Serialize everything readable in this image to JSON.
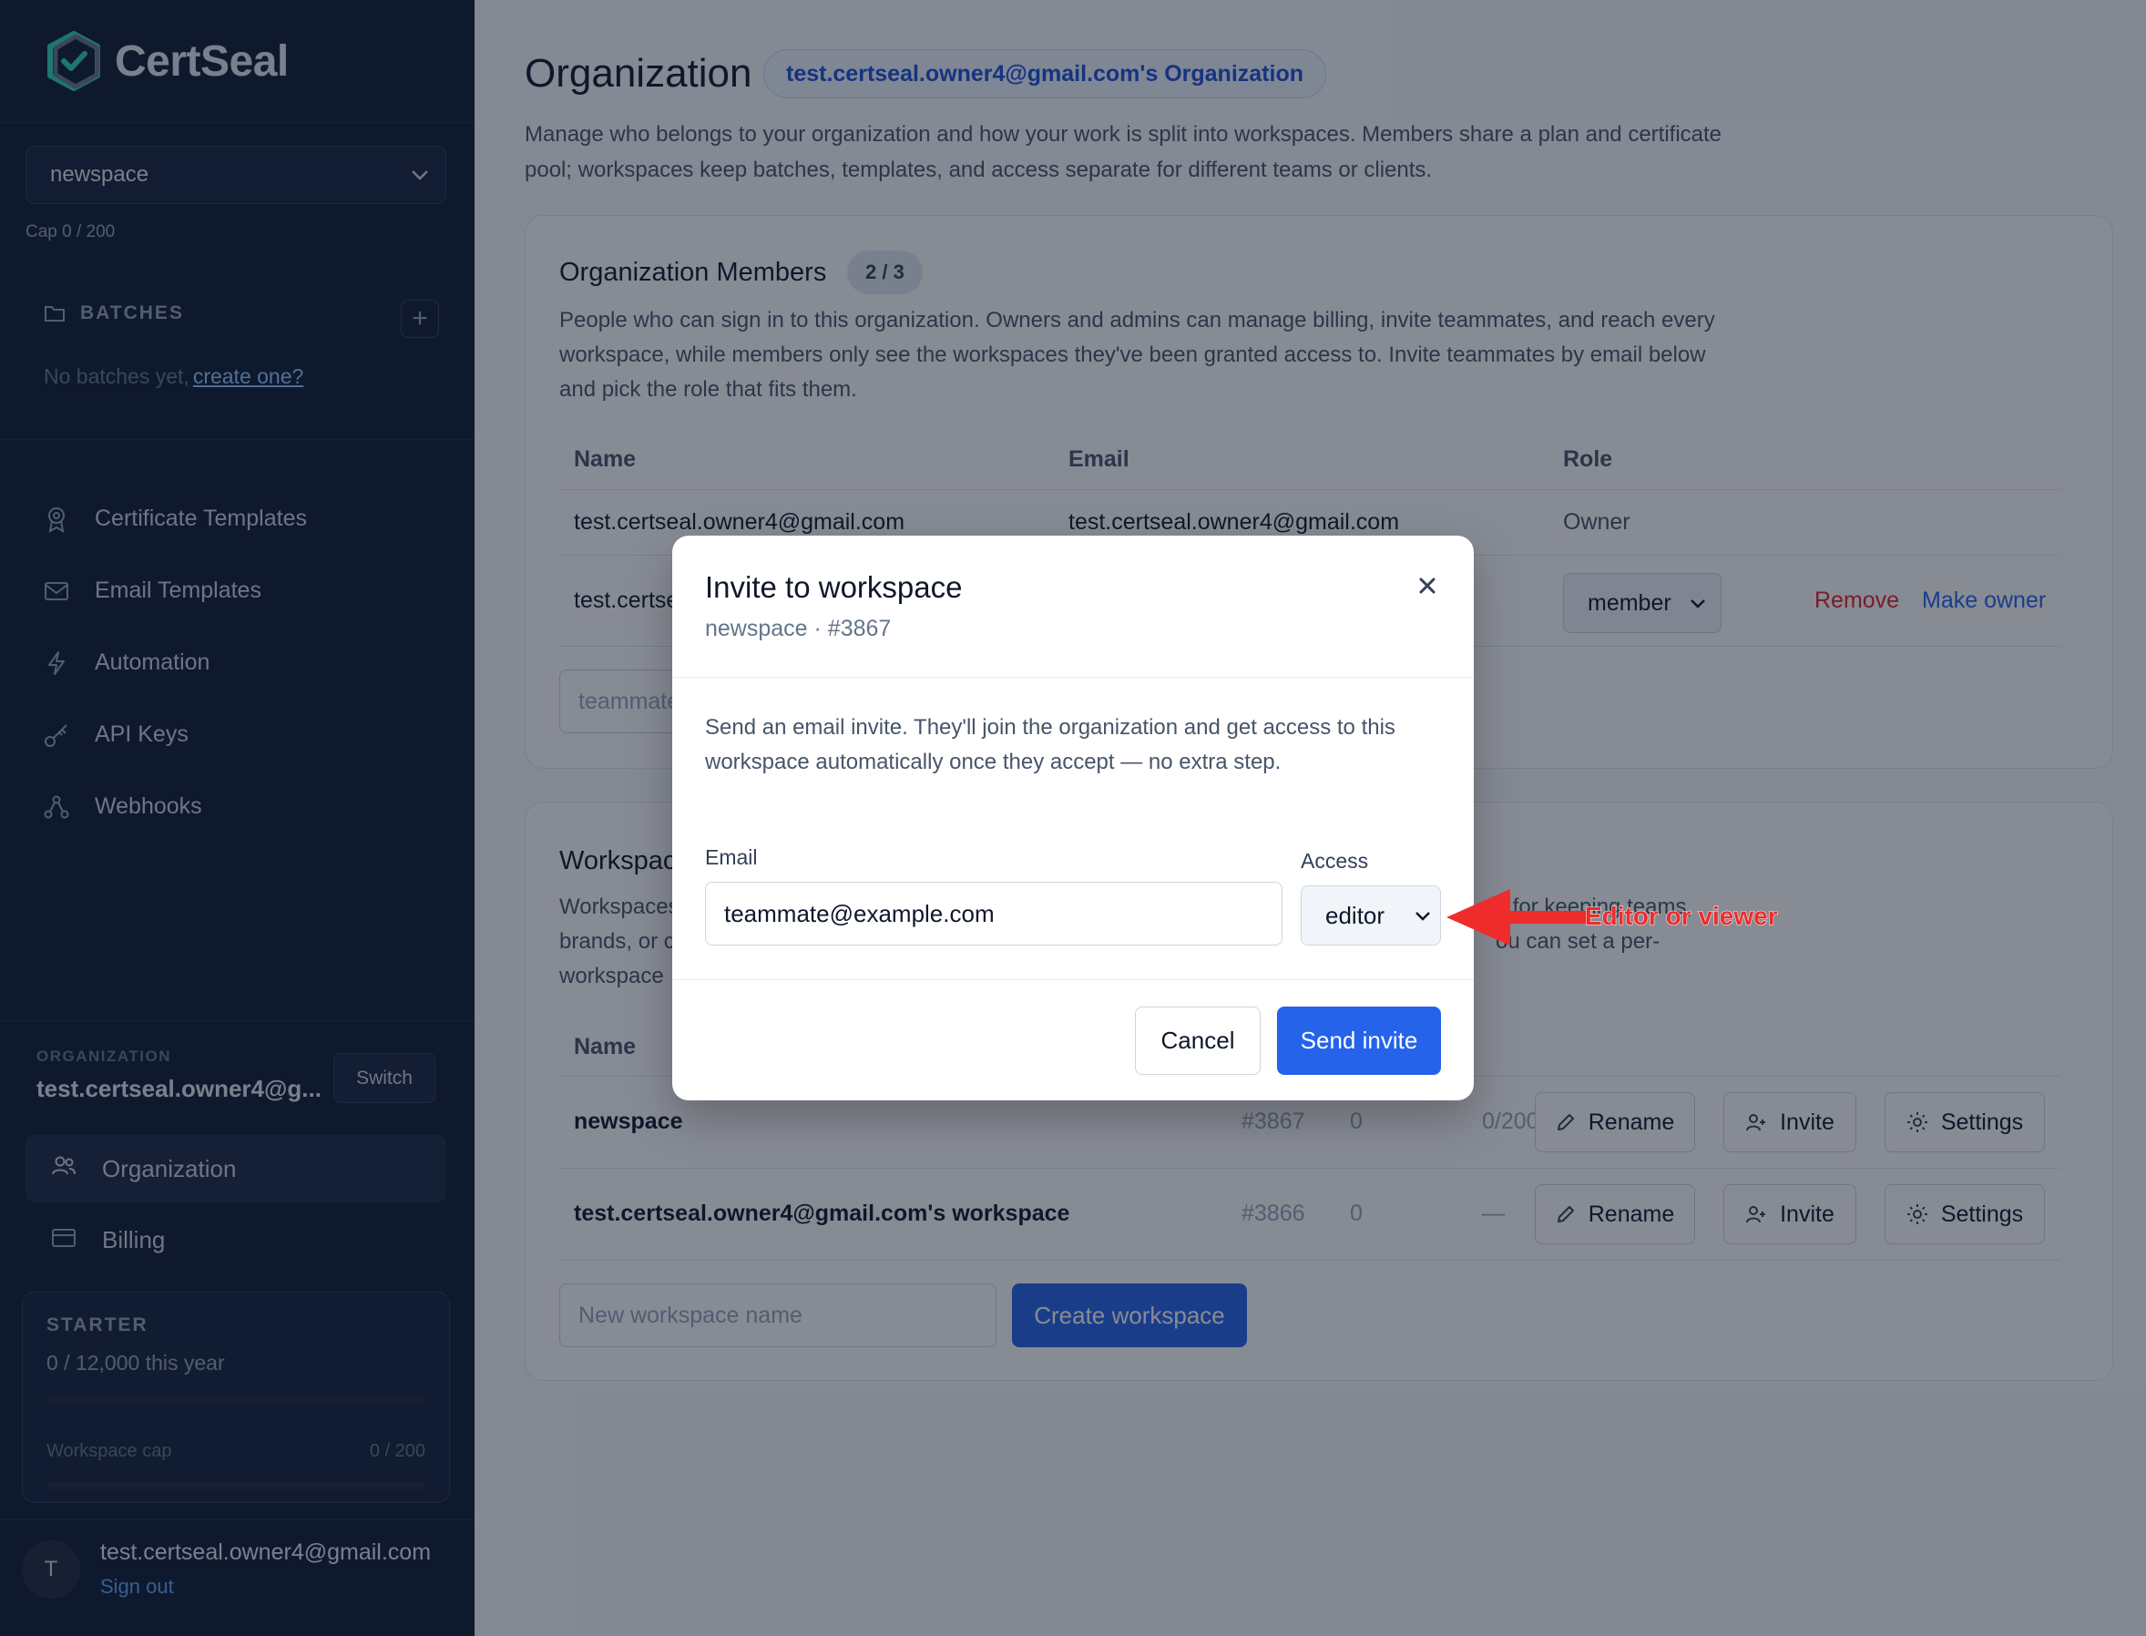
{
  "app": {
    "name": "CertSeal"
  },
  "sidebar": {
    "workspace_select": "newspace",
    "cap": "Cap 0 / 200",
    "batches_label": "BATCHES",
    "no_batches_text": "No batches yet,",
    "create_link": "create one?",
    "nav": [
      {
        "label": "Certificate Templates",
        "icon": "award-icon"
      },
      {
        "label": "Email Templates",
        "icon": "mail-icon"
      },
      {
        "label": "Automation",
        "icon": "bolt-icon"
      },
      {
        "label": "API Keys",
        "icon": "key-icon"
      },
      {
        "label": "Webhooks",
        "icon": "webhook-icon"
      }
    ],
    "organization_label": "ORGANIZATION",
    "organization_name": "test.certseal.owner4@g...",
    "switch_label": "Switch",
    "org_items": [
      {
        "label": "Organization",
        "icon": "users-icon"
      },
      {
        "label": "Billing",
        "icon": "card-icon"
      }
    ],
    "plan": {
      "name": "STARTER",
      "usage": "0 / 12,000 this year",
      "usage_fraction": 0,
      "cap_label": "Workspace cap",
      "cap_value": "0 / 200",
      "cap_fraction": 0
    },
    "user": {
      "initial": "T",
      "email": "test.certseal.owner4@gmail.com",
      "sign_out": "Sign out"
    }
  },
  "main": {
    "title": "Organization",
    "org_pill": "test.certseal.owner4@gmail.com's Organization",
    "description": "Manage who belongs to your organization and how your work is split into workspaces. Members share a plan and certificate pool; workspaces keep batches, templates, and access separate for different teams or clients.",
    "members": {
      "title": "Organization Members",
      "count": "2 / 3",
      "description": "People who can sign in to this organization. Owners and admins can manage billing, invite teammates, and reach every workspace, while members only see the workspaces they've been granted access to. Invite teammates by email below and pick the role that fits them.",
      "columns": [
        "Name",
        "Email",
        "Role"
      ],
      "rows": [
        {
          "name": "test.certseal.owner4@gmail.com",
          "email": "test.certseal.owner4@gmail.com",
          "role": "Owner"
        },
        {
          "name": "test.certse",
          "role_select": "member",
          "remove": "Remove",
          "make_owner": "Make owner"
        }
      ],
      "invite_placeholder": "teammate"
    },
    "workspaces": {
      "title": "Workspac",
      "description_lines": [
        "Workspaces",
        "brands, or c",
        "workspace"
      ],
      "description_right_1": "y for keeping teams,",
      "description_right_2": "ou can set a per-",
      "name_column": "Name",
      "rows": [
        {
          "name": "newspace",
          "id": "#3867",
          "count": "0",
          "cap": "0/200"
        },
        {
          "name": "test.certseal.owner4@gmail.com's workspace",
          "id": "#3866",
          "count": "0",
          "cap": "—"
        }
      ],
      "actions": {
        "rename": "Rename",
        "invite": "Invite",
        "settings": "Settings"
      },
      "new_placeholder": "New workspace name",
      "create_label": "Create workspace"
    }
  },
  "modal": {
    "title": "Invite to workspace",
    "subtitle": "newspace · #3867",
    "description": "Send an email invite. They'll join the organization and get access to this workspace automatically once they accept — no extra step.",
    "email_label": "Email",
    "email_value": "teammate@example.com",
    "access_label": "Access",
    "access_value": "editor",
    "cancel_label": "Cancel",
    "send_label": "Send invite"
  },
  "annotation": {
    "text": "Editor or viewer",
    "color": "#ef2b2b"
  },
  "colors": {
    "sidebar": "#0f1b33",
    "primary": "#2563eb",
    "danger": "#dc2626"
  }
}
